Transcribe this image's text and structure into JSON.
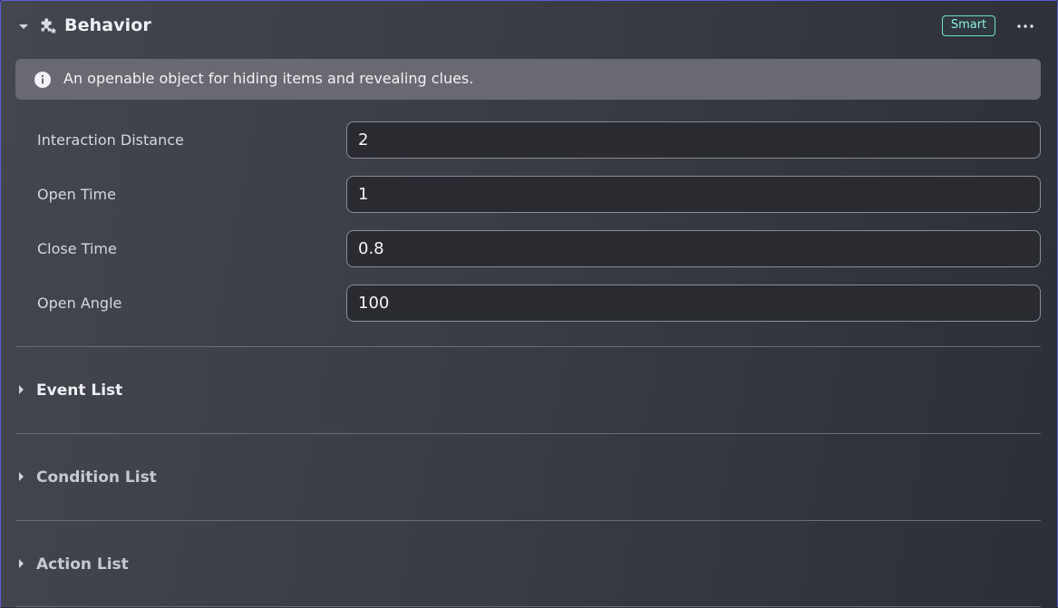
{
  "header": {
    "title": "Behavior",
    "badge": "Smart",
    "icons": [
      "caret-down-icon",
      "puzzle-piece-icon",
      "more-horizontal-icon"
    ]
  },
  "info": {
    "icon": "info-circle-icon",
    "text": "An openable object for hiding items and revealing clues."
  },
  "properties": [
    {
      "label": "Interaction Distance",
      "value": "2"
    },
    {
      "label": "Open Time",
      "value": "1"
    },
    {
      "label": "Close Time",
      "value": "0.8"
    },
    {
      "label": "Open Angle",
      "value": "100"
    }
  ],
  "sections": [
    {
      "label": "Event List",
      "expanded": false
    },
    {
      "label": "Condition List",
      "expanded": false
    },
    {
      "label": "Action List",
      "expanded": false
    }
  ],
  "colors": {
    "accent": "#6fe0cf",
    "border": "#5b5bd6"
  }
}
